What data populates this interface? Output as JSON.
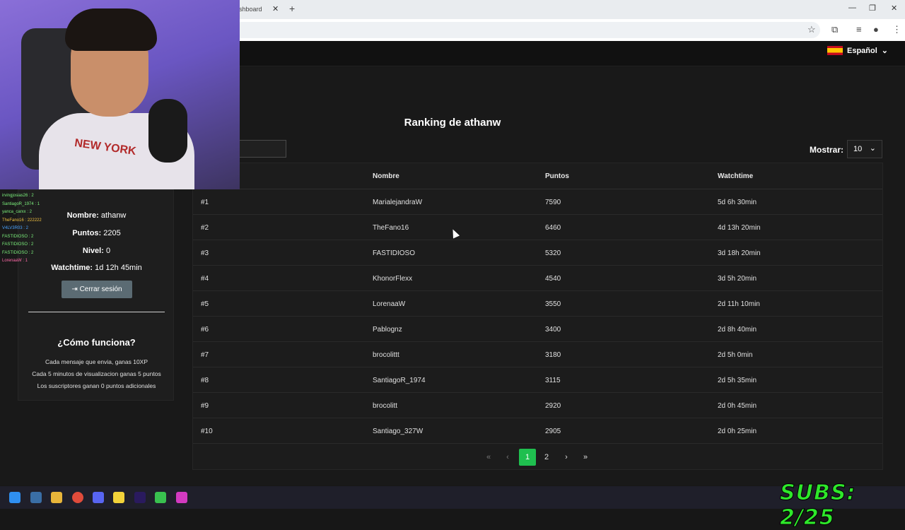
{
  "browser": {
    "tab_title": "shboard",
    "tab_close": "✕",
    "new_tab": "+",
    "window_controls": [
      "—",
      "❐",
      "✕"
    ]
  },
  "header": {
    "language": "Español",
    "language_flag": "spain-flag"
  },
  "ranking": {
    "title": "Ranking de athanw",
    "show_label": "Mostrar:",
    "show_value": "10",
    "columns": [
      "Nombre",
      "Puntos",
      "Watchtime"
    ],
    "rows": [
      {
        "rank": "#1",
        "name": "MarialejandraW",
        "points": "7590",
        "watchtime": "5d 6h 30min"
      },
      {
        "rank": "#2",
        "name": "TheFano16",
        "points": "6460",
        "watchtime": "4d 13h 20min"
      },
      {
        "rank": "#3",
        "name": "FASTIDIOSO",
        "points": "5320",
        "watchtime": "3d 18h 20min"
      },
      {
        "rank": "#4",
        "name": "KhonorFlexx",
        "points": "4540",
        "watchtime": "3d 5h 20min"
      },
      {
        "rank": "#5",
        "name": "LorenaaW",
        "points": "3550",
        "watchtime": "2d 11h 10min"
      },
      {
        "rank": "#6",
        "name": "Pablognz",
        "points": "3400",
        "watchtime": "2d 8h 40min"
      },
      {
        "rank": "#7",
        "name": "brocolittt",
        "points": "3180",
        "watchtime": "2d 5h 0min"
      },
      {
        "rank": "#8",
        "name": "SantiagoR_1974",
        "points": "3115",
        "watchtime": "2d 5h 35min"
      },
      {
        "rank": "#9",
        "name": "brocolitt",
        "points": "2920",
        "watchtime": "2d 0h 45min"
      },
      {
        "rank": "#10",
        "name": "Santiago_327W",
        "points": "2905",
        "watchtime": "2d 0h 25min"
      }
    ],
    "pagination": {
      "first": "«",
      "prev": "‹",
      "pages": [
        "1",
        "2"
      ],
      "current": "1",
      "next": "›",
      "last": "»"
    }
  },
  "profile": {
    "name_label": "Nombre:",
    "name_value": "athanw",
    "points_label": "Puntos:",
    "points_value": "2205",
    "level_label": "Nivel:",
    "level_value": "0",
    "watchtime_label": "Watchtime:",
    "watchtime_value": "1d 12h 45min",
    "logout_label": "Cerrar sesión"
  },
  "how_it_works": {
    "title": "¿Cómo funciona?",
    "lines": [
      "Cada mensaje que envia, ganas 10XP",
      "Cada 5 minutos de visualizacion ganas 5 puntos",
      "Los suscriptores ganan 0 puntos adicionales"
    ]
  },
  "stream_chat": [
    {
      "text": "irvingjosias26 : 2",
      "color": "#7cf07c"
    },
    {
      "text": "SantiagoR_1974 : 1",
      "color": "#7cf07c"
    },
    {
      "text": "yanca_carxx : 2",
      "color": "#7cf07c"
    },
    {
      "text": "TheFano16 : 222222",
      "color": "#f0c040"
    },
    {
      "text": "V4LV3R03 : 2",
      "color": "#4aa3ff"
    },
    {
      "text": "FASTIDIOSO : 2",
      "color": "#7cf07c"
    },
    {
      "text": "FASTIDIOSO : 2",
      "color": "#7cf07c"
    },
    {
      "text": "FASTIDIOSO : 2",
      "color": "#7cf07c"
    },
    {
      "text": "LorenaaW : 1",
      "color": "#ff6aa8"
    }
  ],
  "webcam": {
    "shirt_text": "NEW YORK"
  },
  "overlay": {
    "subs": "SUBS: 2/25"
  },
  "taskbar": {
    "apps": [
      "windows-start-icon",
      "mail-icon",
      "file-explorer-icon",
      "chrome-icon",
      "discord-icon",
      "notes-icon",
      "premiere-icon",
      "xbox-icon",
      "app-icon"
    ]
  },
  "colors": {
    "accent": "#1fbf4f",
    "subs_green": "#2ee82a"
  }
}
